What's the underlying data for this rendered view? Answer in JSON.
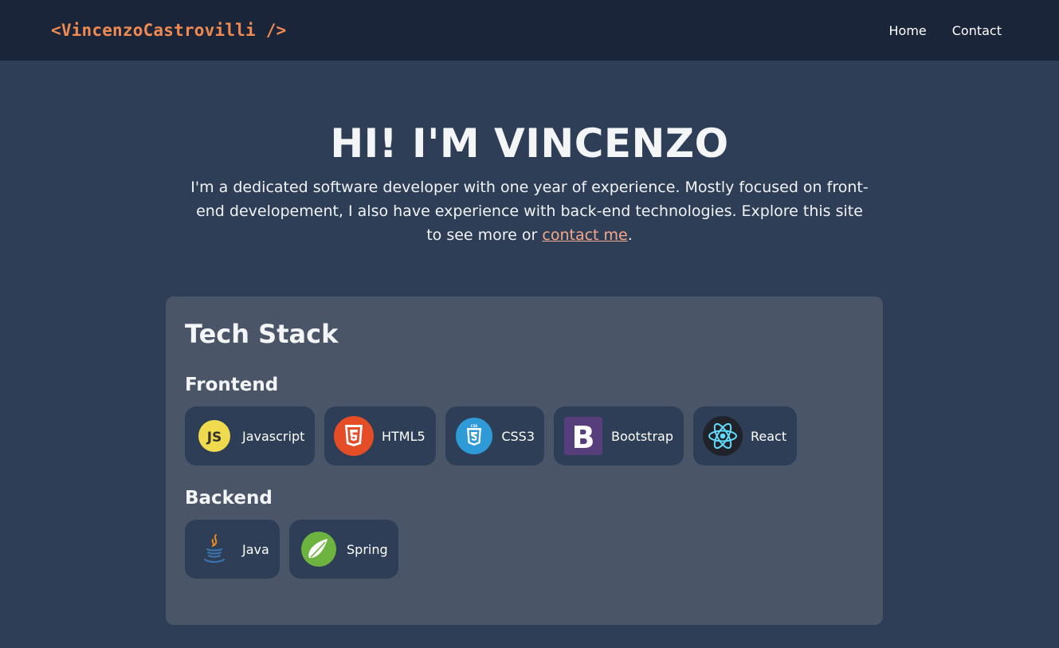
{
  "nav": {
    "logo": "<VincenzoCastrovilli />",
    "links": [
      "Home",
      "Contact"
    ]
  },
  "hero": {
    "title": "HI! I'M VINCENZO",
    "intro": "I'm a dedicated software developer with one year of experience. Mostly focused on front-end developement, I also have experience with back-end technologies. Explore this site to see more or ",
    "link_text": "contact me",
    "end": "."
  },
  "stack": {
    "title": "Tech Stack",
    "frontend": {
      "heading": "Frontend",
      "items": [
        {
          "label": "Javascript",
          "icon": "javascript-icon",
          "color": "#f0db4f"
        },
        {
          "label": "HTML5",
          "icon": "html5-icon",
          "color": "#e44d26"
        },
        {
          "label": "CSS3",
          "icon": "css3-icon",
          "color": "#2e9ad8"
        },
        {
          "label": "Bootstrap",
          "icon": "bootstrap-icon",
          "color": "#563d7c"
        },
        {
          "label": "React",
          "icon": "react-icon",
          "color": "#61dafb"
        }
      ]
    },
    "backend": {
      "heading": "Backend",
      "items": [
        {
          "label": "Java",
          "icon": "java-icon",
          "color": "#ea8a22"
        },
        {
          "label": "Spring",
          "icon": "spring-icon",
          "color": "#6db33f"
        }
      ]
    }
  }
}
